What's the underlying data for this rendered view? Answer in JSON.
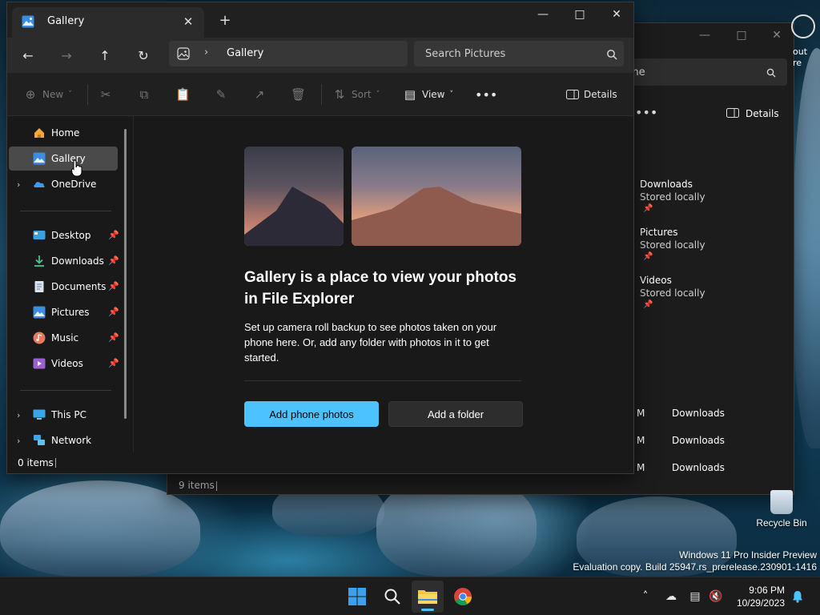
{
  "main_window": {
    "tab_title": "Gallery",
    "address": {
      "location": "Gallery"
    },
    "search": {
      "placeholder": "Search Pictures"
    },
    "toolbar": {
      "new_label": "New",
      "sort_label": "Sort",
      "view_label": "View",
      "details_label": "Details"
    },
    "sidebar": {
      "home": "Home",
      "gallery": "Gallery",
      "onedrive": "OneDrive",
      "desktop": "Desktop",
      "downloads": "Downloads",
      "documents": "Documents",
      "pictures": "Pictures",
      "music": "Music",
      "videos": "Videos",
      "this_pc": "This PC",
      "network": "Network"
    },
    "content": {
      "heading": "Gallery is a place to view your photos in File Explorer",
      "description": "Set up camera roll backup to see photos taken on your phone here. Or, add any folder with photos in it to get started.",
      "primary_button": "Add phone photos",
      "secondary_button": "Add a folder"
    },
    "status": {
      "items": "0 items"
    }
  },
  "background_window": {
    "search_text": "ome",
    "details_label": "Details",
    "quick_access": [
      {
        "name": "Downloads",
        "sub": "Stored locally"
      },
      {
        "name": "Pictures",
        "sub": "Stored locally"
      },
      {
        "name": "Videos",
        "sub": "Stored locally"
      }
    ],
    "recent_rows": [
      {
        "time": "M",
        "location": "Downloads"
      },
      {
        "time": "M",
        "location": "Downloads"
      },
      {
        "time": "M",
        "location": "Downloads"
      }
    ],
    "status": {
      "items": "9 items"
    },
    "edge_text": [
      "out",
      "re"
    ]
  },
  "desktop": {
    "recycle_bin": "Recycle Bin",
    "watermark_line1": "Windows 11 Pro Insider Preview",
    "watermark_line2": "Evaluation copy. Build 25947.rs_prerelease.230901-1416"
  },
  "taskbar": {
    "time": "9:06 PM",
    "date": "10/29/2023"
  },
  "colors": {
    "accent": "#4cc2ff",
    "window_bg": "#191919",
    "toolbar_bg": "#202020",
    "selected": "#4a4a4a"
  }
}
